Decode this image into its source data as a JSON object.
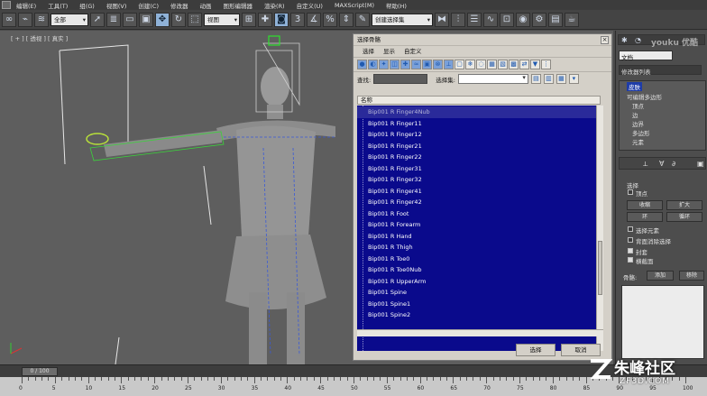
{
  "menubar": {
    "items": [
      "编辑(E)",
      "工具(T)",
      "组(G)",
      "视图(V)",
      "创建(C)",
      "修改器",
      "动画",
      "图形编辑器",
      "渲染(R)",
      "自定义(U)",
      "MAXScript(M)",
      "帮助(H)"
    ]
  },
  "toolbar": {
    "selection_filter": "全部",
    "ref_coord": "视图",
    "named_selection": "创建选择集"
  },
  "viewport": {
    "label": "[ + ] [ 透视 ] [ 真实 ]"
  },
  "dialog": {
    "title": "选择骨骼",
    "close_glyph": "×",
    "menu": [
      "选择",
      "显示",
      "自定义"
    ],
    "find_label": "查找:",
    "selection_set_label": "选择集:",
    "list_header": "名称",
    "items": [
      "Bip001 R Finger4Nub",
      "Bip001 R Finger11",
      "Bip001 R Finger12",
      "Bip001 R Finger21",
      "Bip001 R Finger22",
      "Bip001 R Finger31",
      "Bip001 R Finger32",
      "Bip001 R Finger41",
      "Bip001 R Finger42",
      "Bip001 R Foot",
      "Bip001 R Forearm",
      "Bip001 R Hand",
      "Bip001 R Thigh",
      "Bip001 R Toe0",
      "Bip001 R Toe0Nub",
      "Bip001 R UpperArm",
      "Bip001 Spine",
      "Bip001 Spine1",
      "Bip001 Spine2"
    ],
    "select_button": "选择",
    "cancel_button": "取消"
  },
  "panel": {
    "object_name": "文档",
    "modifier_list": "修改器列表",
    "stack": [
      "皮肤",
      "可编辑多边形",
      "顶点",
      "边",
      "边界",
      "多边形",
      "元素"
    ],
    "rollout_title": "选择",
    "vertex_label": "顶点",
    "shrink": "收缩",
    "grow": "扩大",
    "ring": "环",
    "loop": "循环",
    "select_element": "选择元素",
    "backface": "背面消除选择",
    "envelopes": "封套",
    "cross_sections": "横截面",
    "bones_label": "骨骼:",
    "add_button": "添加",
    "remove_button": "移除"
  },
  "timeline": {
    "frame": "0 / 100",
    "ticks": [
      "0",
      "5",
      "10",
      "15",
      "20",
      "25",
      "30",
      "35",
      "40",
      "45",
      "50",
      "55",
      "60",
      "65",
      "70",
      "75",
      "80",
      "85",
      "90",
      "95",
      "100"
    ]
  },
  "watermarks": {
    "youku": "youku 优酷",
    "zf3d_cn": "朱峰社区",
    "zf3d_en": "ZF3D.COM"
  }
}
